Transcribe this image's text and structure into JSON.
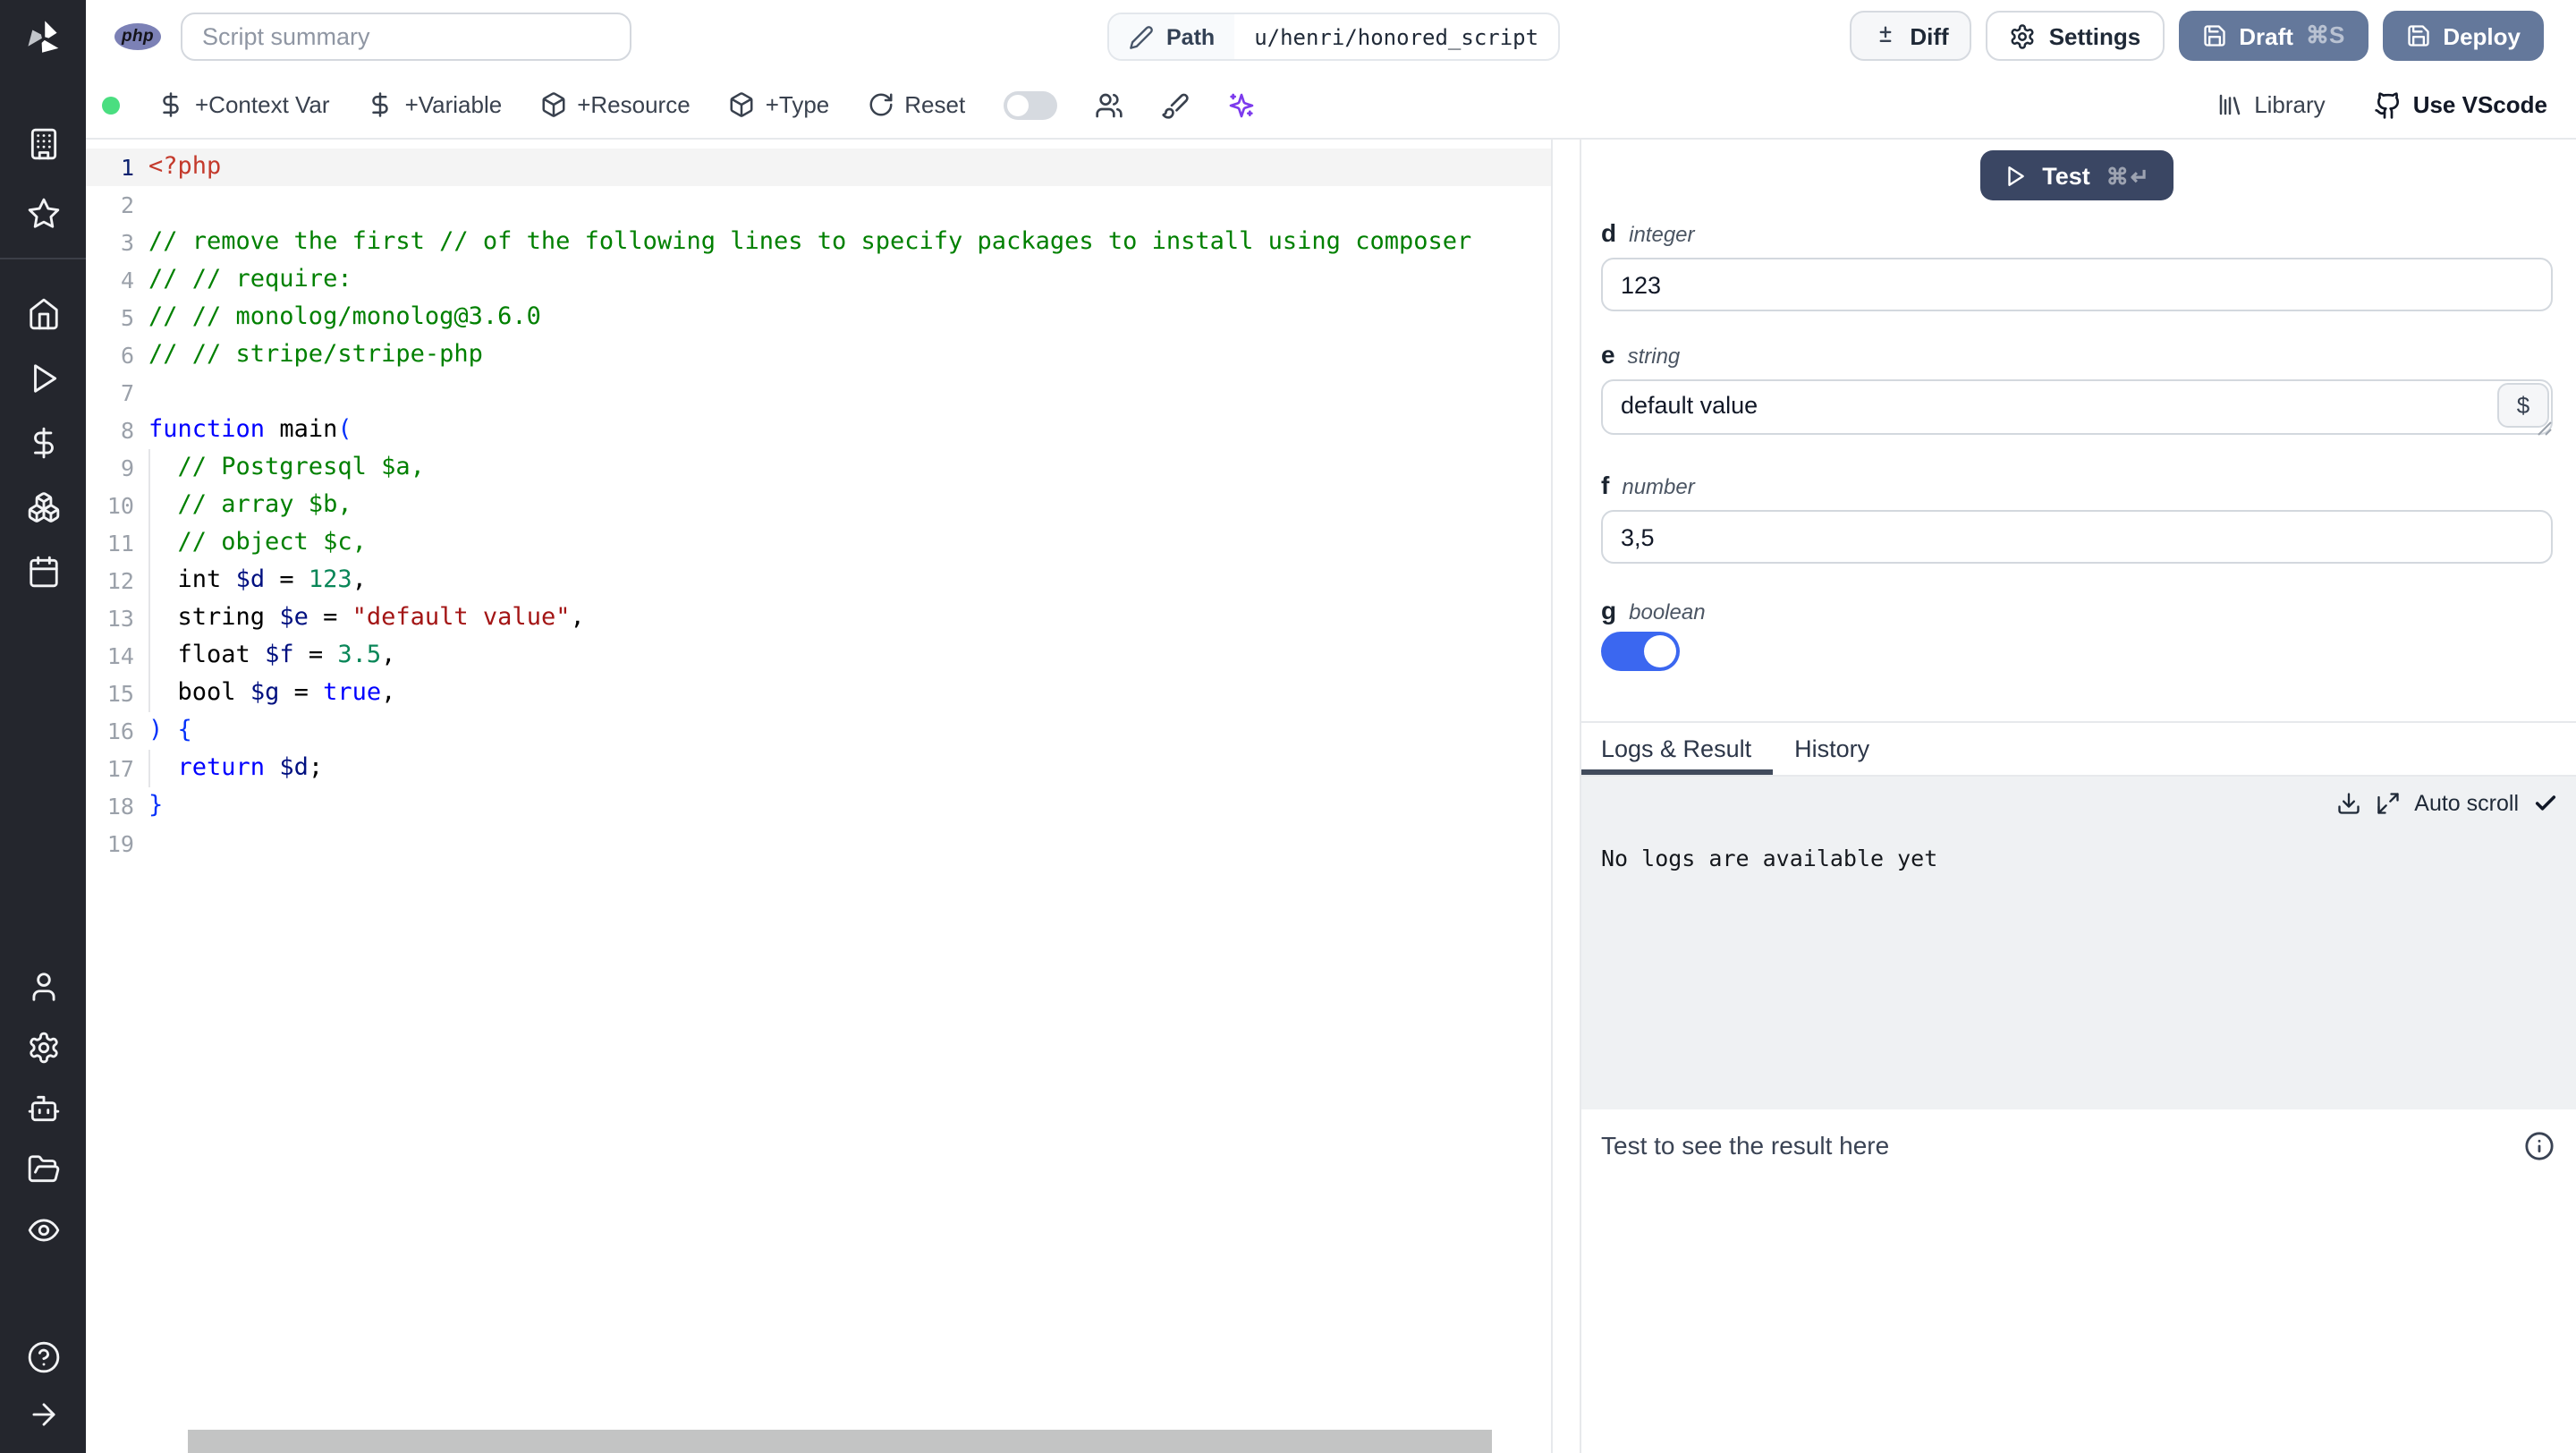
{
  "topbar": {
    "lang_badge": "php",
    "summary_placeholder": "Script summary",
    "path_label": "Path",
    "path_value": "u/henri/honored_script",
    "diff_label": "Diff",
    "settings_label": "Settings",
    "draft_label": "Draft",
    "draft_kbd": "⌘S",
    "deploy_label": "Deploy"
  },
  "toolbar": {
    "context_var": "+Context Var",
    "variable": "+Variable",
    "resource": "+Resource",
    "type": "+Type",
    "reset": "Reset",
    "library": "Library",
    "vscode": "Use VScode"
  },
  "editor": {
    "language": "php",
    "lines": [
      {
        "n": 1,
        "a": true,
        "t": [
          [
            "meta",
            "<?php"
          ]
        ]
      },
      {
        "n": 2,
        "t": []
      },
      {
        "n": 3,
        "t": [
          [
            "comment",
            "// remove the first // of the following lines to specify packages to install using composer"
          ]
        ]
      },
      {
        "n": 4,
        "t": [
          [
            "comment",
            "// // require:"
          ]
        ]
      },
      {
        "n": 5,
        "t": [
          [
            "comment",
            "// // monolog/monolog@3.6.0"
          ]
        ]
      },
      {
        "n": 6,
        "t": [
          [
            "comment",
            "// // stripe/stripe-php"
          ]
        ]
      },
      {
        "n": 7,
        "t": []
      },
      {
        "n": 8,
        "t": [
          [
            "kw",
            "function"
          ],
          [
            "plain",
            " main"
          ],
          [
            "br",
            "("
          ]
        ]
      },
      {
        "n": 9,
        "g": true,
        "t": [
          [
            "comment",
            "  // Postgresql $a,"
          ]
        ]
      },
      {
        "n": 10,
        "g": true,
        "t": [
          [
            "comment",
            "  // array $b,"
          ]
        ]
      },
      {
        "n": 11,
        "g": true,
        "t": [
          [
            "comment",
            "  // object $c,"
          ]
        ]
      },
      {
        "n": 12,
        "g": true,
        "t": [
          [
            "plain",
            "  int "
          ],
          [
            "var",
            "$d"
          ],
          [
            "plain",
            " = "
          ],
          [
            "num",
            "123"
          ],
          [
            "plain",
            ","
          ]
        ]
      },
      {
        "n": 13,
        "g": true,
        "t": [
          [
            "plain",
            "  string "
          ],
          [
            "var",
            "$e"
          ],
          [
            "plain",
            " = "
          ],
          [
            "str",
            "\"default value\""
          ],
          [
            "plain",
            ","
          ]
        ]
      },
      {
        "n": 14,
        "g": true,
        "t": [
          [
            "plain",
            "  float "
          ],
          [
            "var",
            "$f"
          ],
          [
            "plain",
            " = "
          ],
          [
            "num",
            "3.5"
          ],
          [
            "plain",
            ","
          ]
        ]
      },
      {
        "n": 15,
        "g": true,
        "t": [
          [
            "plain",
            "  bool "
          ],
          [
            "var",
            "$g"
          ],
          [
            "plain",
            " = "
          ],
          [
            "kw",
            "true"
          ],
          [
            "plain",
            ","
          ]
        ]
      },
      {
        "n": 16,
        "t": [
          [
            "br",
            ") {"
          ]
        ]
      },
      {
        "n": 17,
        "g": true,
        "t": [
          [
            "plain",
            "  "
          ],
          [
            "kw",
            "return"
          ],
          [
            "plain",
            " "
          ],
          [
            "var",
            "$d"
          ],
          [
            "plain",
            ";"
          ]
        ]
      },
      {
        "n": 18,
        "t": [
          [
            "br",
            "}"
          ]
        ]
      },
      {
        "n": 19,
        "t": []
      }
    ]
  },
  "panel": {
    "test_label": "Test",
    "test_kbd": "⌘↵",
    "fields": {
      "d": {
        "name": "d",
        "type": "integer",
        "value": "123"
      },
      "e": {
        "name": "e",
        "type": "string",
        "value": "default value",
        "insert_btn": "$"
      },
      "f": {
        "name": "f",
        "type": "number",
        "value": "3,5"
      },
      "g": {
        "name": "g",
        "type": "boolean",
        "on": true
      }
    },
    "tabs": {
      "logs": "Logs & Result",
      "history": "History"
    },
    "logs": {
      "auto_scroll_label": "Auto scroll",
      "empty_message": "No logs are available yet"
    },
    "result": {
      "placeholder": "Test to see the result here"
    }
  },
  "colors": {
    "status_dot": "#4ade80",
    "toggle_on": "#3b67f0",
    "primary_button": "#64789b",
    "test_button": "#3a4663",
    "ai_accent": "#7c3aed"
  }
}
